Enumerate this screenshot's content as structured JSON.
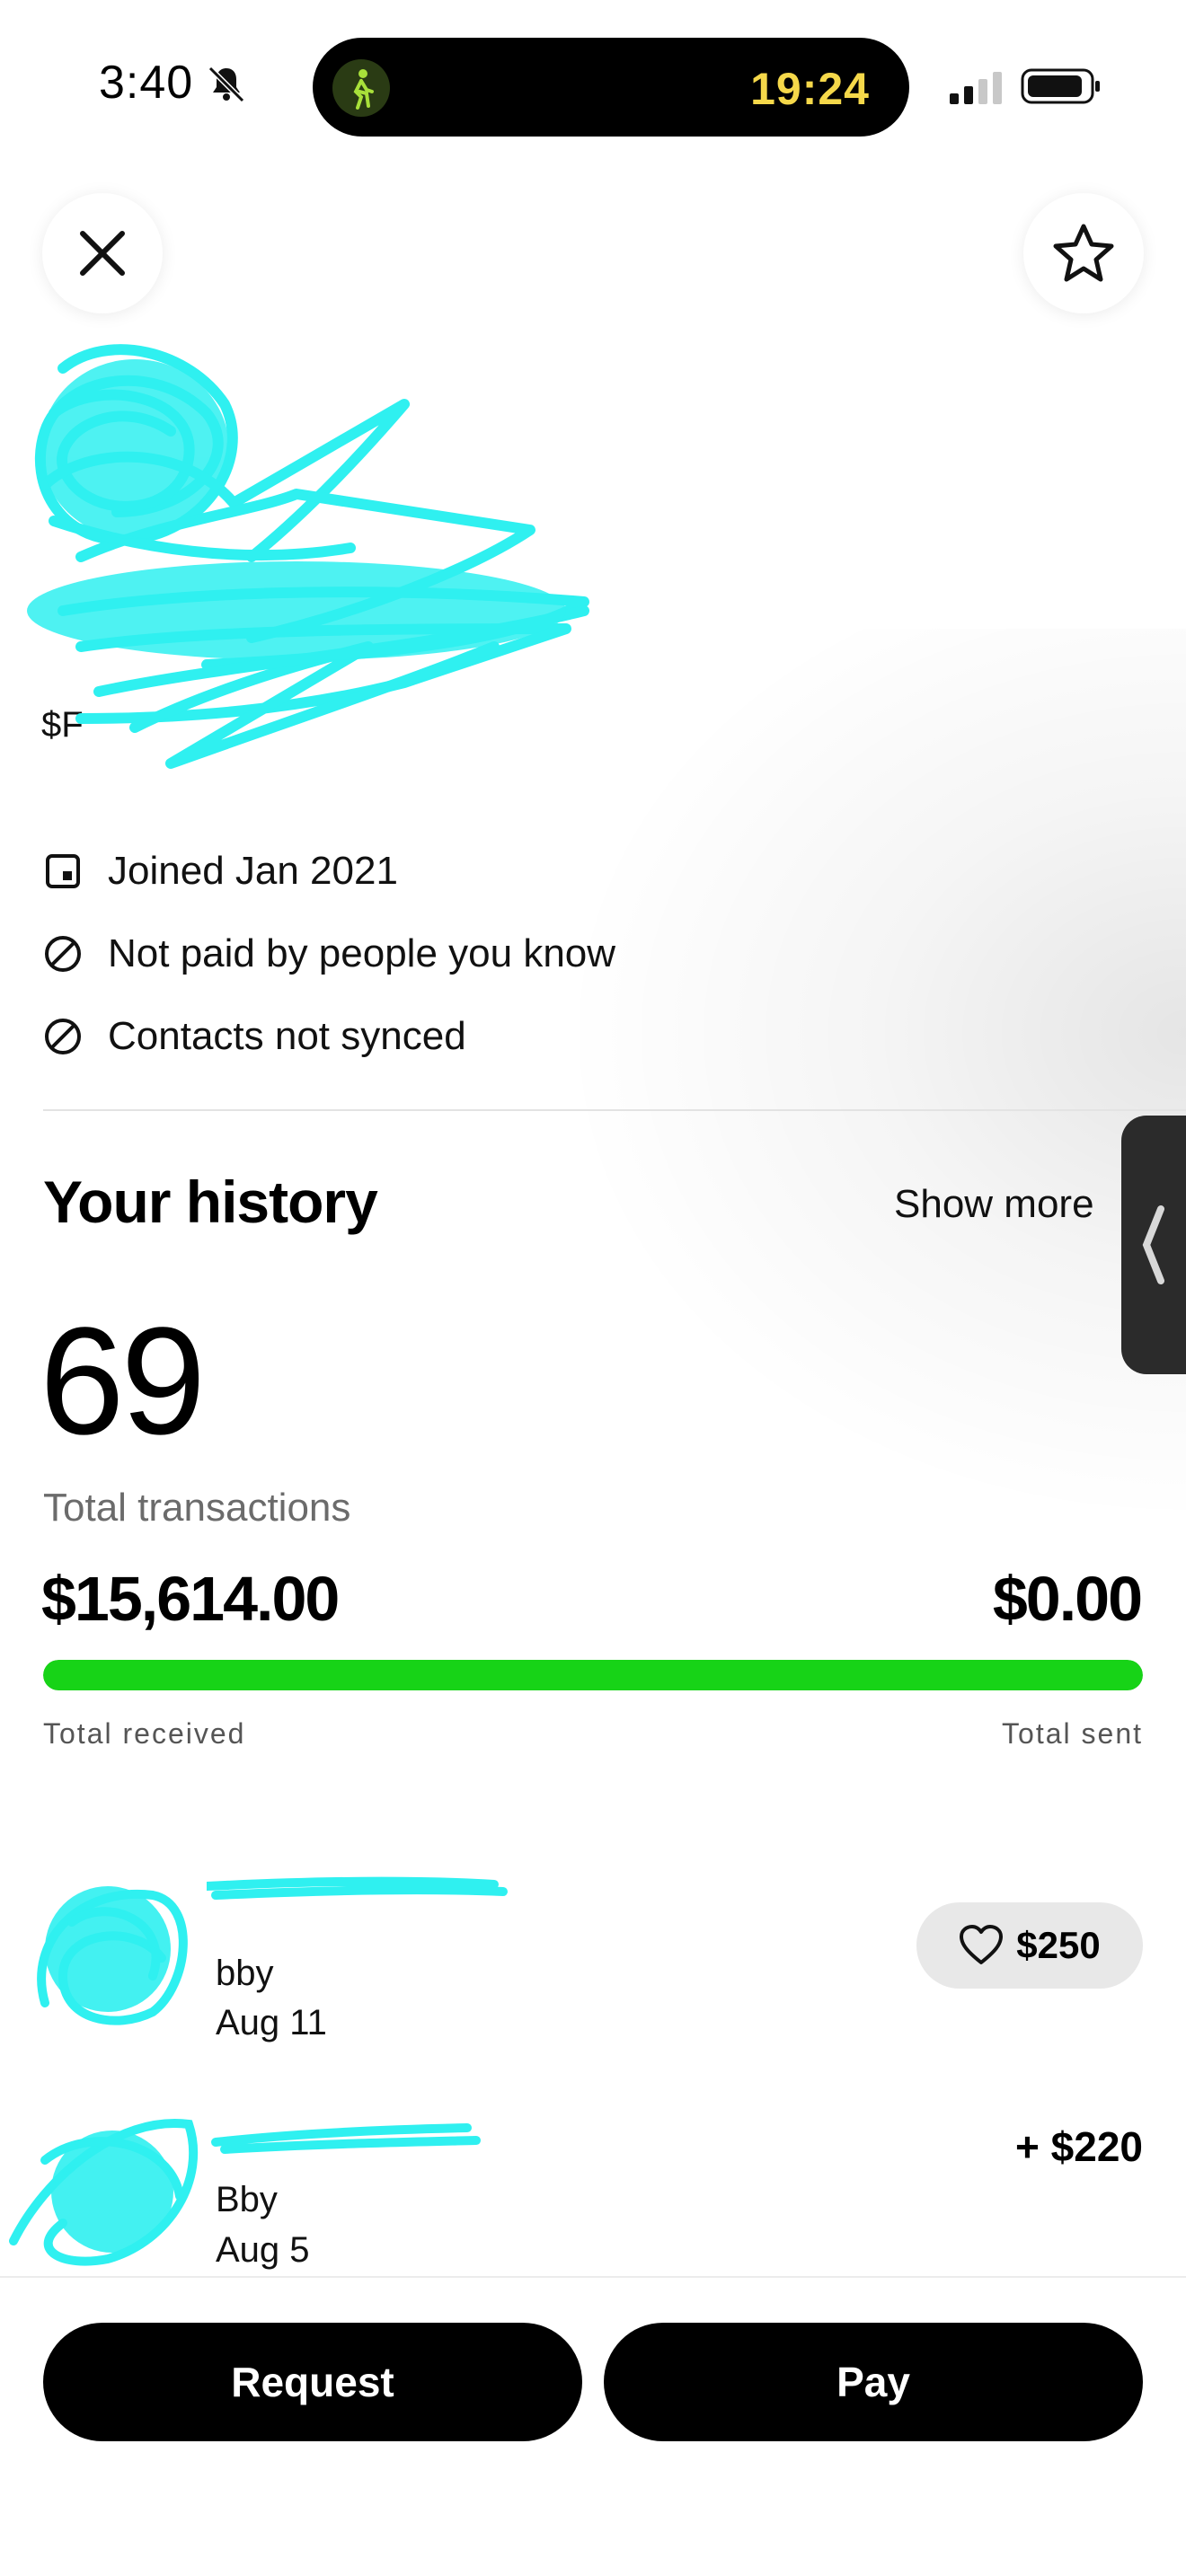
{
  "status_bar": {
    "time": "3:40",
    "activity_time": "19:24"
  },
  "profile": {
    "handle_partial": "$F",
    "info": [
      {
        "icon": "calendar-icon",
        "text": "Joined Jan 2021"
      },
      {
        "icon": "slash-circle-icon",
        "text": "Not paid by people you know"
      },
      {
        "icon": "slash-circle-icon",
        "text": "Contacts not synced"
      }
    ]
  },
  "history": {
    "title": "Your history",
    "show_more": "Show more",
    "total_transactions": "69",
    "total_transactions_label": "Total transactions",
    "total_received": "$15,614.00",
    "total_sent": "$0.00",
    "received_label": "Total received",
    "sent_label": "Total sent",
    "received_fraction": 1.0
  },
  "transactions": [
    {
      "note": "bby",
      "date": "Aug 11",
      "amount": "$250",
      "liked": true
    },
    {
      "note": "Bby",
      "date": "Aug 5",
      "amount": "+ $220",
      "liked": false
    }
  ],
  "actions": {
    "request": "Request",
    "pay": "Pay"
  },
  "colors": {
    "progress": "#17d317",
    "redaction": "#2ff0f0",
    "island_time": "#f5d84a"
  }
}
